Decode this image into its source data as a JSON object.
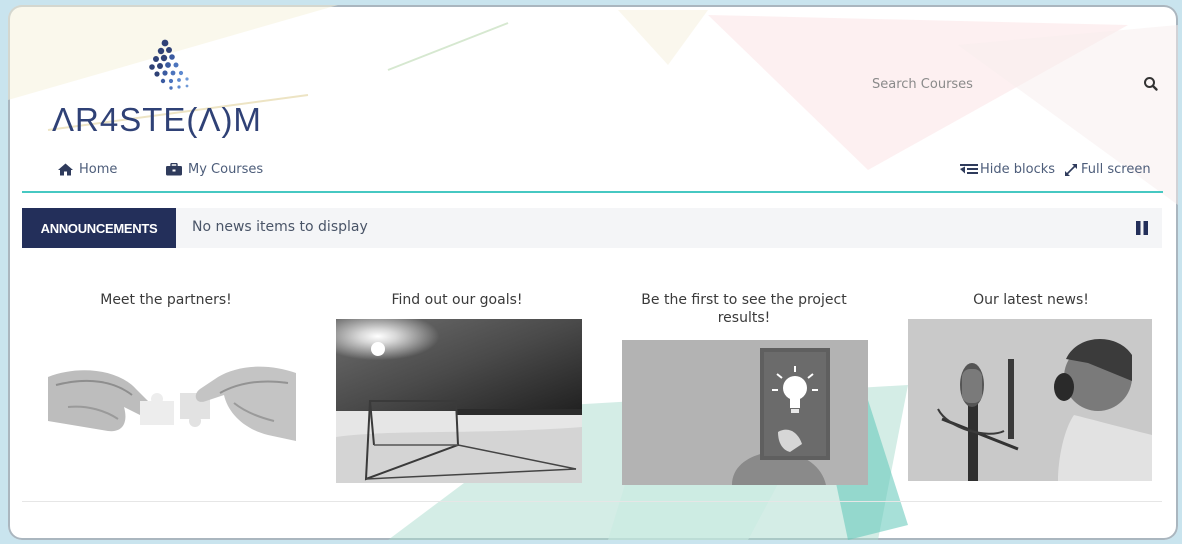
{
  "site": {
    "logo_text": "ΛR4STE(Λ)M"
  },
  "search": {
    "placeholder": "Search Courses"
  },
  "nav": {
    "home_label": "Home",
    "courses_label": "My Courses",
    "hide_blocks_label": "Hide blocks",
    "full_screen_label": "Full screen"
  },
  "announcements": {
    "label": "ANNOUNCEMENTS",
    "text": "No news items to display"
  },
  "cards": [
    {
      "title": "Meet the partners!"
    },
    {
      "title": "Find out our goals!"
    },
    {
      "title": "Be the first to see the project results!"
    },
    {
      "title": "Our latest news!"
    }
  ],
  "colors": {
    "brand_navy": "#232f5a",
    "accent_teal": "#46c8c2",
    "logo_blue": "#2f4176"
  }
}
